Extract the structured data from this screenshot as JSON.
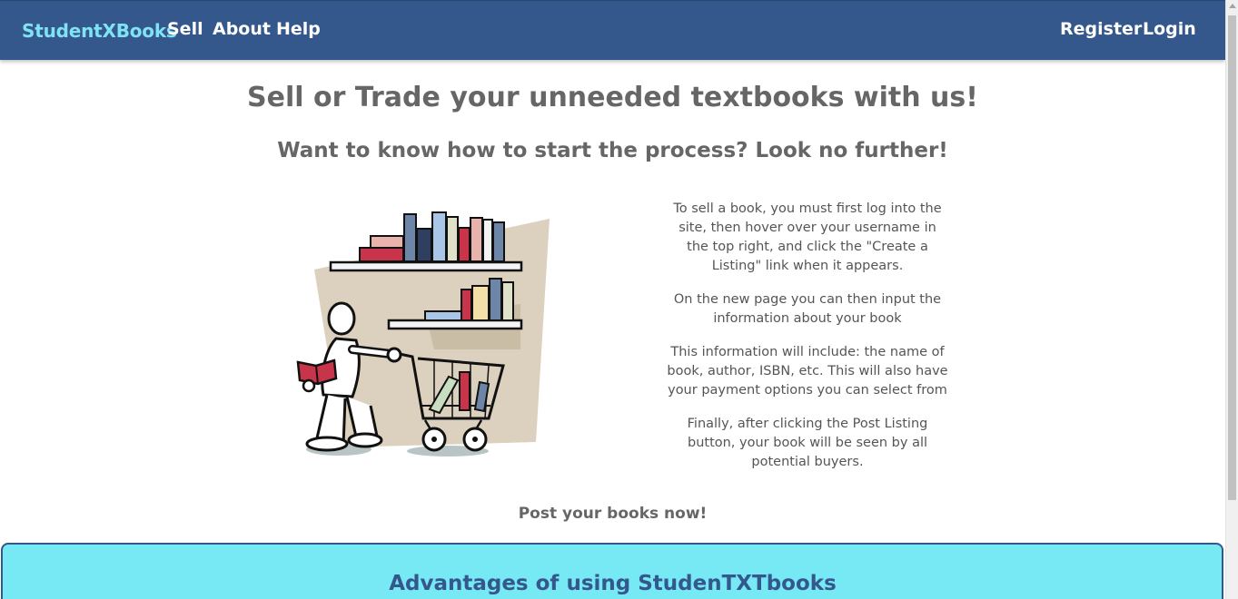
{
  "navbar": {
    "brand": "StudentXBooks",
    "links": [
      "Sell",
      "About",
      "Help"
    ],
    "right_links": [
      "Register",
      "Login"
    ]
  },
  "main": {
    "title": "Sell or Trade your unneeded textbooks with us!",
    "subtitle": "Want to know how to start the process? Look no further!",
    "steps": [
      "To sell a book, you must first log into the site, then hover over your username in the top right, and click the \"Create a Listing\" link when it appears.",
      "On the new page you can then input the information about your book",
      "This information will include: the name of book, author, ISBN, etc. This will also have your payment options you can select from",
      "Finally, after clicking the Post Listing button, your book will be seen by all potential buyers."
    ],
    "cta": "Post your books now!"
  },
  "advantages": {
    "title": "Advantages of using StudenTXTbooks"
  },
  "colors": {
    "navbar_bg": "#34578c",
    "brand": "#7fe3f3",
    "advantages_bg": "#76e9f5",
    "heading_text": "#666666"
  },
  "illustration": {
    "icon": "shopper-with-bookshelf-illustration"
  }
}
